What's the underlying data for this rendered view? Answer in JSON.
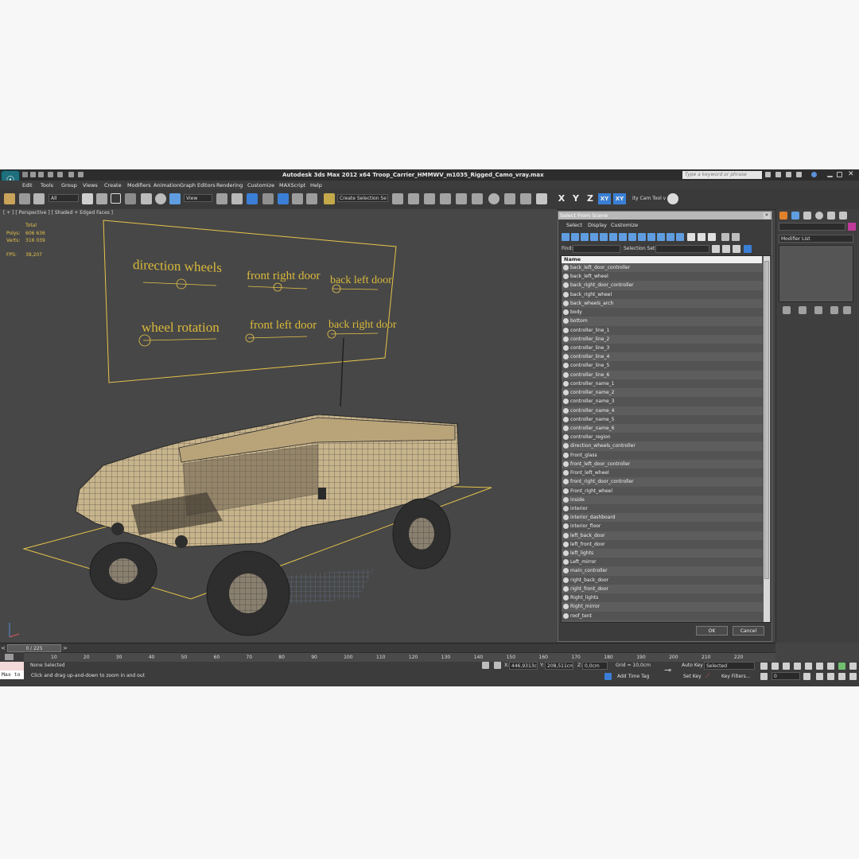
{
  "app": {
    "title": "Autodesk 3ds Max  2012 x64     Troop_Carrier_HMMWV_m1035_Rigged_Camo_vray.max",
    "logo": "3ds-max-logo"
  },
  "search": {
    "placeholder": "Type a keyword or phrase"
  },
  "menu": [
    "Edit",
    "Tools",
    "Group",
    "Views",
    "Create",
    "Modifiers",
    "Animation",
    "Graph Editors",
    "Rendering",
    "Customize",
    "MAXScript",
    "Help"
  ],
  "toolbar": {
    "selection_filter": "All",
    "ref_coord": "View",
    "named_selection": "Create Selection Se",
    "axes": [
      "X",
      "Y",
      "Z",
      "XY",
      "XY"
    ],
    "extra_tool": "ity Cam Tool v"
  },
  "viewport": {
    "label": "[ + ] [ Perspective ] [ Shaded + Edged Faces ]",
    "stats": {
      "total_label": "Total",
      "polys_label": "Polys:",
      "polys": "606 636",
      "verts_label": "Verts:",
      "verts": "316 039",
      "fps_label": "FPS:",
      "fps": "38,207"
    },
    "controller_labels": [
      "direction wheels",
      "front right door",
      "back left door",
      "wheel rotation",
      "front left door",
      "back right door"
    ]
  },
  "dialog": {
    "title": "Select From Scene",
    "tabs": [
      "Select",
      "Display",
      "Customize"
    ],
    "find_label": "Find:",
    "selection_set_label": "Selection Set:",
    "column_name": "Name",
    "items": [
      "back_left_door_controller",
      "back_left_wheel",
      "back_right_door_controller",
      "back_right_wheel",
      "back_wheels_arch",
      "body",
      "bottom",
      "controller_line_1",
      "controller_line_2",
      "controller_line_3",
      "controller_line_4",
      "controller_line_5",
      "controller_line_6",
      "controller_name_1",
      "controller_name_2",
      "controller_name_3",
      "controller_name_4",
      "controller_name_5",
      "controller_name_6",
      "controller_region",
      "direction_wheels_controller",
      "Front_glass",
      "front_left_door_controller",
      "Front_left_wheel",
      "front_right_door_controller",
      "Front_right_wheel",
      "inside",
      "interior",
      "interior_dashboard",
      "interior_floor",
      "left_back_door",
      "left_front_door",
      "left_lights",
      "Left_mirror",
      "main_controller",
      "right_back_door",
      "right_front_door",
      "Right_lights",
      "Right_mirror",
      "roof_tent"
    ],
    "ok": "OK",
    "cancel": "Cancel"
  },
  "command_panel": {
    "modifier_list": "Modifier List"
  },
  "timeline": {
    "frame": "0 / 225",
    "ticks": [
      "10",
      "20",
      "30",
      "40",
      "50",
      "60",
      "70",
      "80",
      "90",
      "100",
      "110",
      "120",
      "130",
      "140",
      "150",
      "160",
      "170",
      "180",
      "190",
      "200",
      "210",
      "220"
    ]
  },
  "status": {
    "maxscript": "Max to",
    "selection": "None Selected",
    "prompt": "Click and drag up-and-down to zoom in and out",
    "x_label": "X:",
    "x": "446,9313c",
    "y_label": "Y:",
    "y": "208,511cm",
    "z_label": "Z:",
    "z": "0,0cm",
    "grid": "Grid = 10,0cm",
    "add_time_tag": "Add Time Tag",
    "auto_key": "Auto Key",
    "set_key": "Set Key",
    "key_mode": "Selected",
    "key_filters": "Key Filters...",
    "current_frame": "0"
  },
  "colors": {
    "ui_dark": "#444444",
    "wire": "#e6c34a",
    "vehicle": "#c8b48c",
    "selected_blue": "#3a7fd5"
  }
}
